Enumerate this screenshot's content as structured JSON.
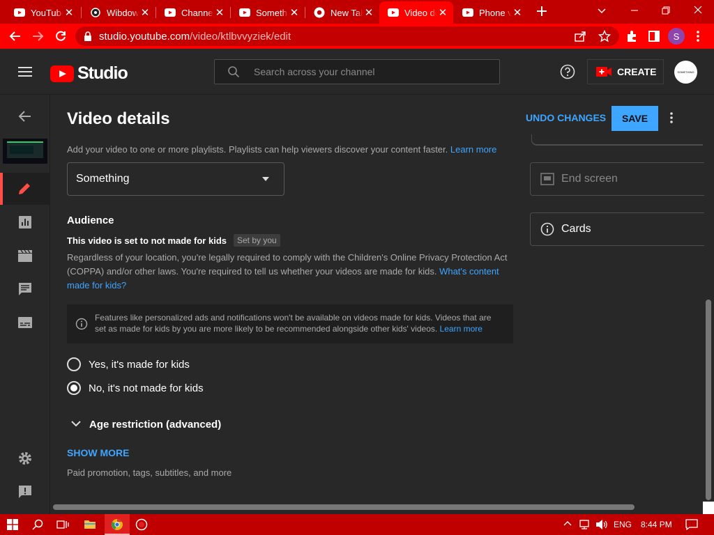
{
  "browser": {
    "tabs": [
      {
        "title": "YouTube",
        "icon": "youtube-icon"
      },
      {
        "title": "Wibdow",
        "icon": "page-icon"
      },
      {
        "title": "Channel",
        "icon": "youtube-icon"
      },
      {
        "title": "Something",
        "icon": "youtube-icon"
      },
      {
        "title": "New Tab",
        "icon": "chrome-icon"
      },
      {
        "title": "Video details",
        "icon": "youtube-icon",
        "active": true
      },
      {
        "title": "Phone verification",
        "icon": "youtube-icon"
      }
    ],
    "url_domain": "studio.youtube.com",
    "url_path": "/video/ktlbvvyziek/edit",
    "profile_initial": "S",
    "accent_color": "#ff0000"
  },
  "header": {
    "logo_text": "Studio",
    "search_placeholder": "Search across your channel",
    "create_label": "CREATE",
    "avatar_text": "SOMETHING"
  },
  "page": {
    "title": "Video details",
    "undo_label": "UNDO CHANGES",
    "save_label": "SAVE",
    "playlist_desc": "Add your video to one or more playlists. Playlists can help viewers discover your content faster.",
    "playlist_learn_more": "Learn more",
    "playlist_value": "Something",
    "audience_heading": "Audience",
    "audience_status": "This video is set to not made for kids",
    "audience_badge": "Set by you",
    "coppa_line1": "Regardless of your location, you're legally required to comply with the Children's Online Privacy Protection Act",
    "coppa_line2": "(COPPA) and/or other laws. You're required to tell us whether your videos are made for kids.",
    "coppa_link1": "What's content",
    "coppa_link2": "made for kids?",
    "info_line1": "Features like personalized ads and notifications won't be available on videos made for kids. Videos that are",
    "info_line2": "set as made for kids by you are more likely to be recommended alongside other kids' videos.",
    "info_learn_more": "Learn more",
    "radio_yes": "Yes, it's made for kids",
    "radio_no": "No, it's not made for kids",
    "selected_option": "no",
    "age_restriction": "Age restriction (advanced)",
    "show_more": "SHOW MORE",
    "show_more_desc": "Paid promotion, tags, subtitles, and more"
  },
  "right_panel": {
    "end_screen": "End screen",
    "cards": "Cards"
  },
  "taskbar": {
    "language": "ENG",
    "time": "8:44 PM"
  }
}
